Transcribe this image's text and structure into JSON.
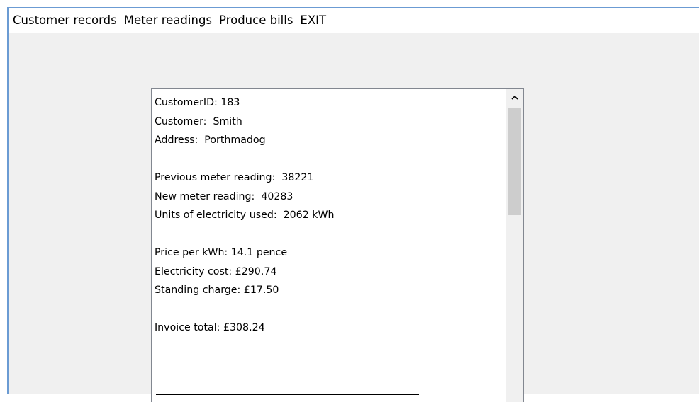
{
  "menu": {
    "items": [
      {
        "label": "Customer records"
      },
      {
        "label": "Meter readings"
      },
      {
        "label": "Produce bills"
      },
      {
        "label": "EXIT"
      }
    ]
  },
  "invoice": {
    "customer_id": "CustomerID: 183",
    "customer": "Customer:  Smith",
    "address": "Address:  Porthmadog",
    "previous_reading": "Previous meter reading:  38221",
    "new_reading": "New meter reading:  40283",
    "units_used": "Units of electricity used:  2062 kWh",
    "price_per_kwh": "Price per kWh: 14.1 pence",
    "electricity_cost": "Electricity cost: £290.74",
    "standing_charge": "Standing charge: £17.50",
    "invoice_total": "Invoice total: £308.24"
  },
  "scrollbar": {
    "up_icon": "chevron-up-icon"
  },
  "colors": {
    "window_bg": "#f0f0f0",
    "window_border": "#6b9bd3",
    "textbox_border": "#828790",
    "scroll_thumb": "#cdcdcd"
  }
}
